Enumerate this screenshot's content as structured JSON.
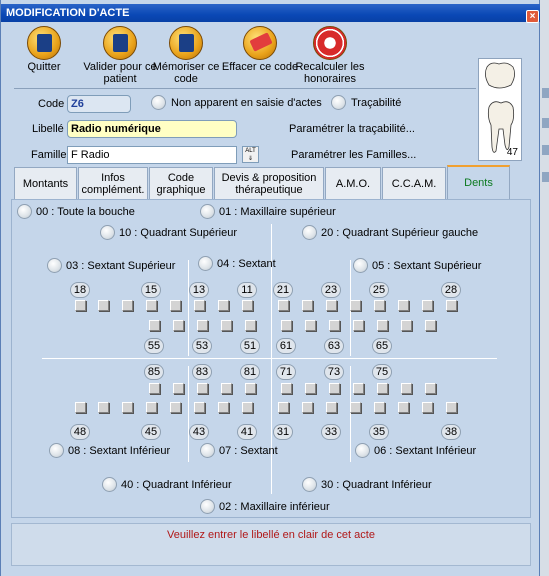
{
  "window": {
    "title": "MODIFICATION D'ACTE",
    "close_symbol": "×"
  },
  "toolbar": [
    {
      "name": "quit-button",
      "label": "Quitter",
      "icon": "door-icon"
    },
    {
      "name": "validate-patient-button",
      "label": "Valider pour ce patient",
      "icon": "validate-icon"
    },
    {
      "name": "memorize-code-button",
      "label": "Mémoriser ce code",
      "icon": "memorize-icon"
    },
    {
      "name": "clear-code-button",
      "label": "Effacer ce code",
      "icon": "eraser-icon"
    },
    {
      "name": "recalculate-fees-button",
      "label": "Recalculer les honoraires",
      "icon": "lifebuoy-icon"
    }
  ],
  "form": {
    "code_label": "Code",
    "code_value": "Z6",
    "not_visible_label": "Non apparent en saisie d'actes",
    "traceability_label": "Traçabilité",
    "libelle_label": "Libellé",
    "libelle_value": "Radio numérique",
    "param_traceability": "Paramétrer la traçabilité...",
    "famille_label": "Famille",
    "famille_value": "F Radio",
    "alt_label": "ALT",
    "param_families": "Paramétrer les Familles...",
    "tooth_number": "47"
  },
  "tabs": [
    "Montants",
    "Infos complément.",
    "Code graphique",
    "Devis & proposition thérapeutique",
    "A.M.O.",
    "C.C.A.M.",
    "Dents"
  ],
  "options": {
    "o00": "00 : Toute la bouche",
    "o01": "01 : Maxillaire supérieur",
    "o10": "10 : Quadrant Supérieur",
    "o20": "20 : Quadrant Supérieur gauche",
    "o03": "03 : Sextant Supérieur",
    "o04": "04 : Sextant",
    "o05": "05 : Sextant Supérieur",
    "o08": "08 : Sextant Inférieur",
    "o07": "07 : Sextant",
    "o06": "06 : Sextant Inférieur",
    "o40": "40 : Quadrant Inférieur",
    "o30": "30 : Quadrant Inférieur",
    "o02": "02 : Maxillaire inférieur"
  },
  "teeth": {
    "upper_top": [
      "18",
      "15",
      "13",
      "11",
      "21",
      "23",
      "25",
      "28"
    ],
    "upper_bottom": [
      "55",
      "53",
      "51",
      "61",
      "63",
      "65"
    ],
    "lower_top": [
      "85",
      "83",
      "81",
      "71",
      "73",
      "75"
    ],
    "lower_bottom": [
      "48",
      "45",
      "43",
      "41",
      "31",
      "33",
      "35",
      "38"
    ]
  },
  "status": "Veuillez entrer le libellé en clair de cet acte"
}
